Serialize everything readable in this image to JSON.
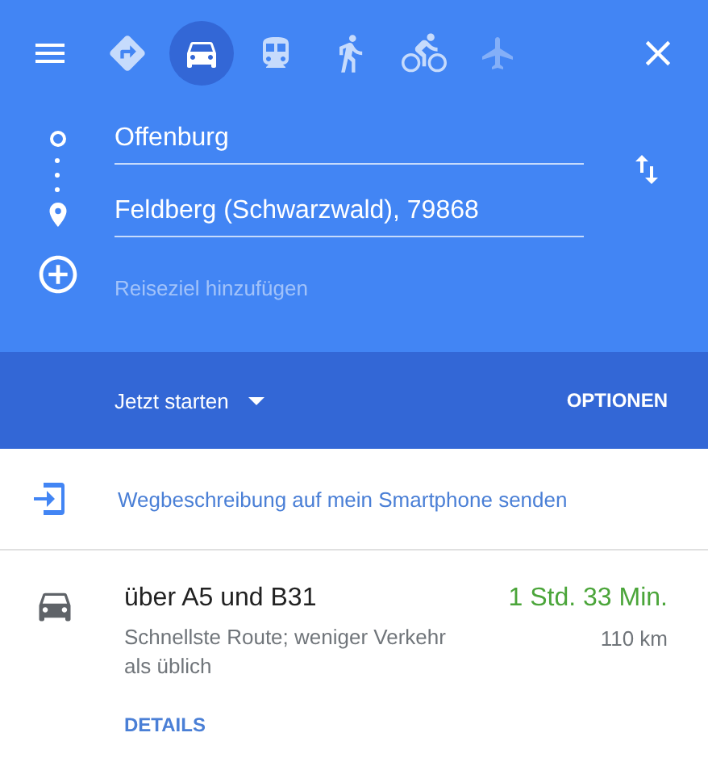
{
  "modes": [
    {
      "kind": "best",
      "selected": false,
      "disabled": false
    },
    {
      "kind": "car",
      "selected": true,
      "disabled": false
    },
    {
      "kind": "transit",
      "selected": false,
      "disabled": false
    },
    {
      "kind": "walk",
      "selected": false,
      "disabled": false
    },
    {
      "kind": "bike",
      "selected": false,
      "disabled": false
    },
    {
      "kind": "flight",
      "selected": false,
      "disabled": true
    }
  ],
  "origin": {
    "value": "Offenburg"
  },
  "destination": {
    "value": "Feldberg (Schwarzwald), 79868"
  },
  "add_destination": {
    "placeholder": "Reiseziel hinzufügen"
  },
  "departure": {
    "label": "Jetzt starten"
  },
  "options_button": "OPTIONEN",
  "send_to_phone": "Wegbeschreibung auf mein Smartphone senden",
  "routes": [
    {
      "title": "über A5 und B31",
      "description": "Schnellste Route; weniger Verkehr als üblich",
      "duration": "1 Std. 33 Min.",
      "distance": "110 km",
      "details": "DETAILS"
    }
  ]
}
